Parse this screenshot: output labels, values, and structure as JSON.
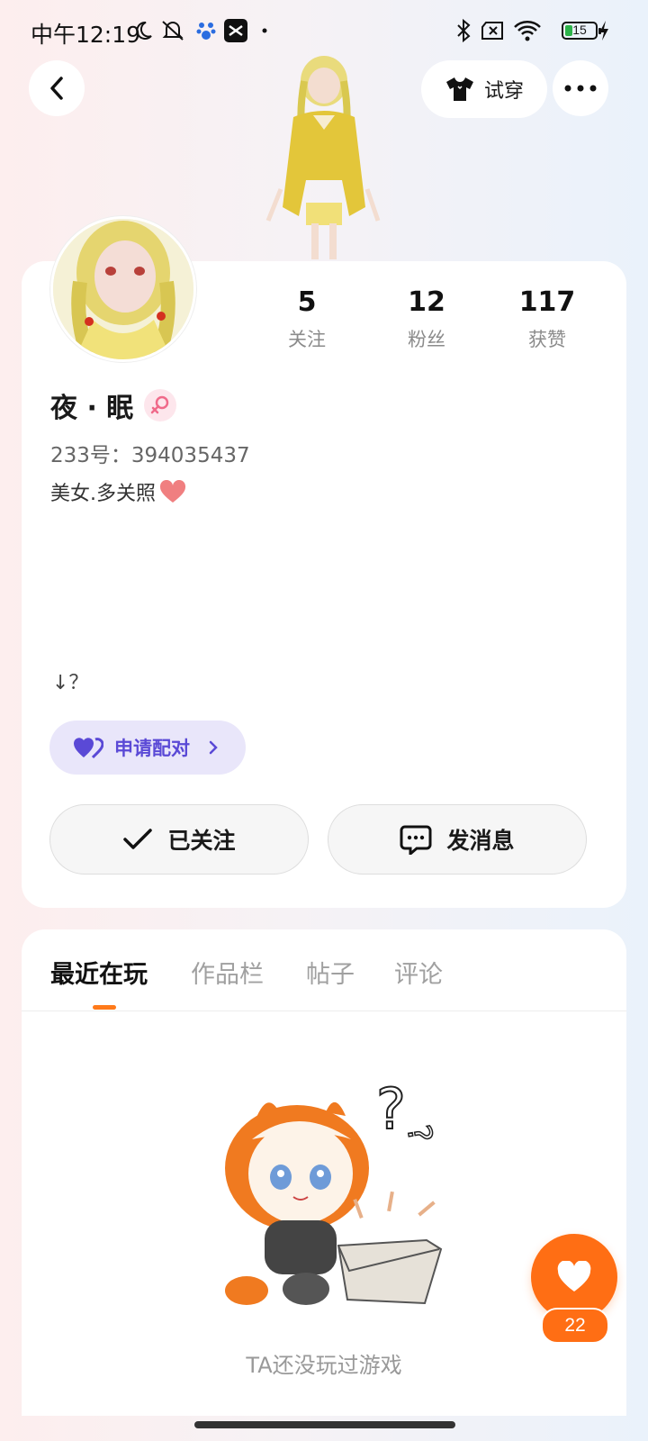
{
  "status_bar": {
    "time": "中午12:19",
    "battery": "15"
  },
  "header": {
    "try_on_label": "试穿"
  },
  "profile": {
    "stats": [
      {
        "value": "5",
        "label": "关注"
      },
      {
        "value": "12",
        "label": "粉丝"
      },
      {
        "value": "117",
        "label": "获赞"
      }
    ],
    "name": "夜 · 眠",
    "uid": "233号：394035437",
    "bio": "美女.多关照",
    "extra_line": "↓？",
    "match_label": "申请配对",
    "follow_label": "已关注",
    "message_label": "发消息"
  },
  "tabs": [
    {
      "label": "最近在玩",
      "active": true
    },
    {
      "label": "作品栏",
      "active": false
    },
    {
      "label": "帖子",
      "active": false
    },
    {
      "label": "评论",
      "active": false
    }
  ],
  "empty_state": {
    "text": "TA还没玩过游戏"
  },
  "like": {
    "count": "22"
  },
  "colors": {
    "accent": "#ff6e14",
    "match": "#5a49d6",
    "gender": "#f06a8a"
  }
}
